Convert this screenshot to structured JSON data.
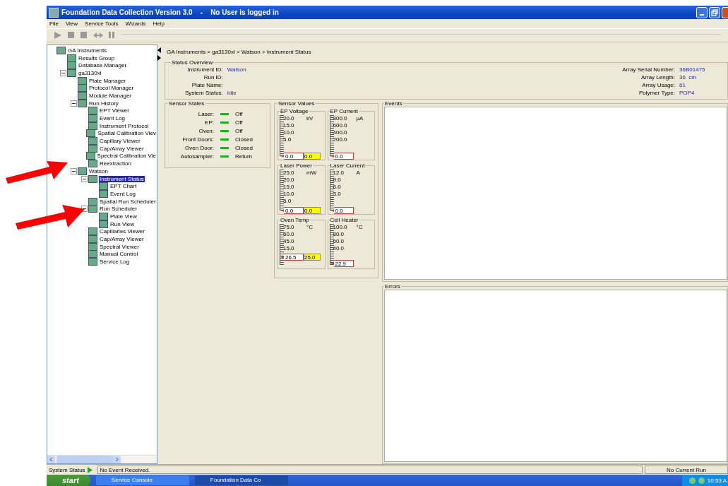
{
  "window": {
    "title": "Foundation Data Collection Version 3.0    -    No User is logged in"
  },
  "menu": [
    "File",
    "View",
    "Service Tools",
    "Wizards",
    "Help"
  ],
  "tree": [
    {
      "label": "GA Instruments",
      "selected": false,
      "children": [
        {
          "label": "Results Group",
          "selected": false
        },
        {
          "label": "Database Manager",
          "selected": false
        },
        {
          "label": "ga3130xl",
          "selected": false,
          "expanded": true,
          "children": [
            {
              "label": "Plate Manager",
              "selected": false
            },
            {
              "label": "Protocol Manager",
              "selected": false
            },
            {
              "label": "Module Manager",
              "selected": false
            },
            {
              "label": "Run History",
              "selected": false,
              "expanded": true,
              "children": [
                {
                  "label": "EPT Viewer",
                  "selected": false
                },
                {
                  "label": "Event Log",
                  "selected": false
                },
                {
                  "label": "Instrument Protocol",
                  "selected": false
                },
                {
                  "label": "Spatial Calibration Viev",
                  "selected": false
                },
                {
                  "label": "Capillary Viewer",
                  "selected": false
                },
                {
                  "label": "Cap/Array Viewer",
                  "selected": false
                },
                {
                  "label": "Spectral Calibration Vie",
                  "selected": false
                },
                {
                  "label": "Reextraction",
                  "selected": false
                }
              ]
            },
            {
              "label": "Watson",
              "selected": false,
              "expanded": true,
              "children": [
                {
                  "label": "Instrument Status",
                  "selected": true,
                  "expanded": true,
                  "children": [
                    {
                      "label": "EPT Chart",
                      "selected": false
                    },
                    {
                      "label": "Event Log",
                      "selected": false
                    }
                  ]
                },
                {
                  "label": "Spatial Run Scheduler",
                  "selected": false
                },
                {
                  "label": "Run Scheduler",
                  "selected": false,
                  "expanded": true,
                  "children": [
                    {
                      "label": "Plate View",
                      "selected": false
                    },
                    {
                      "label": "Run View",
                      "selected": false
                    }
                  ]
                },
                {
                  "label": "Capillaries Viewer",
                  "selected": false
                },
                {
                  "label": "Cap/Array Viewer",
                  "selected": false
                },
                {
                  "label": "Spectral Viewer",
                  "selected": false
                },
                {
                  "label": "Manual Control",
                  "selected": false
                },
                {
                  "label": "Service Log",
                  "selected": false
                }
              ]
            }
          ]
        }
      ]
    }
  ],
  "breadcrumb": "GA Instruments > ga3130xl > Watson > Instrument Status",
  "status_overview": {
    "title": "Status Overview",
    "left": [
      {
        "label": "Instrument ID:",
        "value": "Watson"
      },
      {
        "label": "Run ID:"
      },
      {
        "label": "Plate Name:"
      },
      {
        "label": "System Status:",
        "value": "Idle"
      }
    ],
    "right": [
      {
        "label": "Array Serial Number:",
        "value": "36B01475"
      },
      {
        "label": "Array Length:",
        "value": "36  cm"
      },
      {
        "label": "Array Usage:",
        "value": "61"
      },
      {
        "label": "Polymer Type:",
        "value": "POP4"
      }
    ]
  },
  "sensor_states": {
    "title": "Sensor States",
    "items": [
      {
        "label": "Laser:",
        "on": true,
        "value": "Off"
      },
      {
        "label": "EP:",
        "on": true,
        "value": "Off"
      },
      {
        "label": "Oven:",
        "on": true,
        "value": "Off"
      },
      {
        "label": "Front Doors:",
        "on": true,
        "value": "Closed"
      },
      {
        "label": "Oven Door:",
        "on": true,
        "value": "Closed"
      },
      {
        "label": "Autosampler:",
        "on": true,
        "value": "Return"
      }
    ]
  },
  "sensor_values": {
    "title": "Sensor Values",
    "gauges": [
      {
        "title": "EP Voltage",
        "unit": "kV",
        "ticks": [
          "20.0",
          "15.0",
          "10.0",
          "5.0"
        ],
        "level": 0,
        "reading": "0.0",
        "setpoint": "0.0"
      },
      {
        "title": "EP Current",
        "unit": "µA",
        "ticks": [
          "800.0",
          "600.0",
          "400.0",
          "200.0"
        ],
        "level": 0,
        "reading": "0.0"
      },
      {
        "title": "Laser Power",
        "unit": "mW",
        "ticks": [
          "25.0",
          "20.0",
          "15.0",
          "10.0",
          "5.0"
        ],
        "level": 0,
        "reading": "0.0",
        "setpoint": "0.0"
      },
      {
        "title": "Laser Current",
        "unit": "A",
        "ticks": [
          "12.0",
          "9.0",
          "6.0",
          "3.0"
        ],
        "level": 0,
        "reading": "0.0"
      },
      {
        "title": "Oven Temp",
        "unit": "°C",
        "ticks": [
          "75.0",
          "60.0",
          "45.0",
          "15.0"
        ],
        "level": 0.19,
        "reading": "26.5",
        "setpoint": "25.0"
      },
      {
        "title": "Cell Heater",
        "unit": "°C",
        "ticks": [
          "100.0",
          "80.0",
          "60.0",
          "40.0"
        ],
        "level": 0.04,
        "reading": "22.9"
      }
    ]
  },
  "events": {
    "title": "Events"
  },
  "errors": {
    "title": "Errors"
  },
  "status_bar": {
    "label": "System Status",
    "message": "No Event Received.",
    "run": "No Current Run"
  },
  "taskbar": {
    "start": "start",
    "tasks": [
      {
        "label": "Service Console",
        "selected": false
      },
      {
        "label": "Foundation Data Co",
        "selected": true
      }
    ],
    "clock": "10:53 A"
  }
}
